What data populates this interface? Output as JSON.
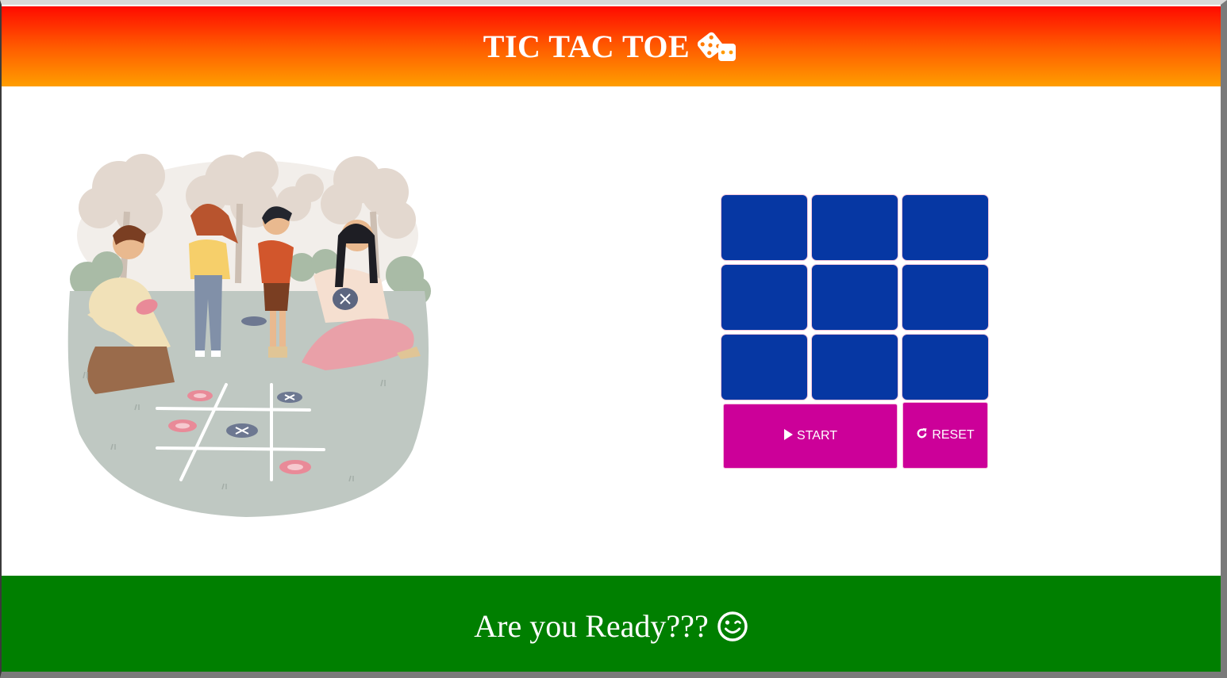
{
  "header": {
    "title": "TIC TAC TOE",
    "icon": "dice-icon",
    "gradient": [
      "#ff0a00",
      "#ff9e00"
    ]
  },
  "illustration": {
    "description_icon": "family-playing-tic-tac-toe-illustration"
  },
  "board": {
    "cells": [
      "",
      "",
      "",
      "",
      "",
      "",
      "",
      "",
      ""
    ],
    "cell_color": "#0637a3"
  },
  "controls": {
    "start_label": "START",
    "start_icon": "play-icon",
    "reset_label": "RESET",
    "reset_icon": "refresh-icon",
    "button_color": "#cc0099"
  },
  "footer": {
    "message": "Are you Ready???",
    "icon": "smile-wink-icon",
    "color": "#007f00"
  }
}
